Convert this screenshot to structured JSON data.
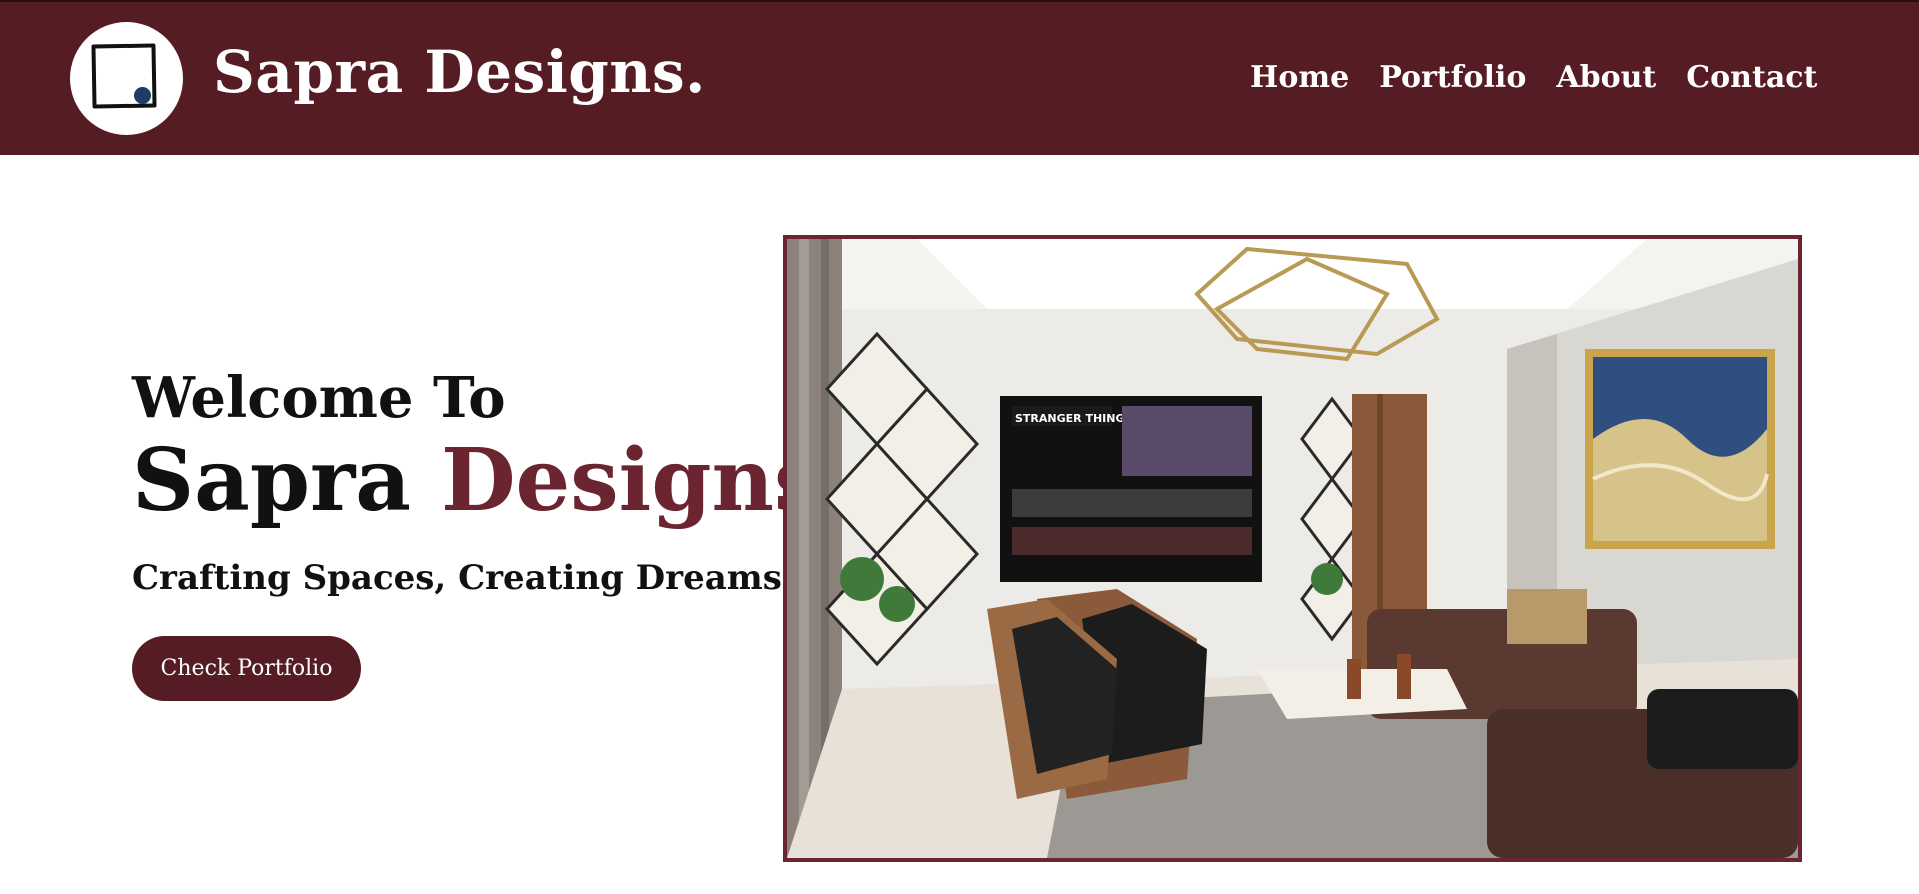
{
  "header": {
    "brand": "Sapra Designs.",
    "nav": [
      "Home",
      "Portfolio",
      "About",
      "Contact"
    ]
  },
  "hero": {
    "welcome": "Welcome To",
    "title_main": "Sapra",
    "title_accent": "Designs.",
    "tagline": "Crafting Spaces, Creating Dreams",
    "cta_label": "Check Portfolio",
    "tv_show": "STRANGER THINGS"
  },
  "colors": {
    "brand_bg": "#561c24",
    "accent": "#6b2530",
    "text": "#111111",
    "white": "#ffffff"
  }
}
